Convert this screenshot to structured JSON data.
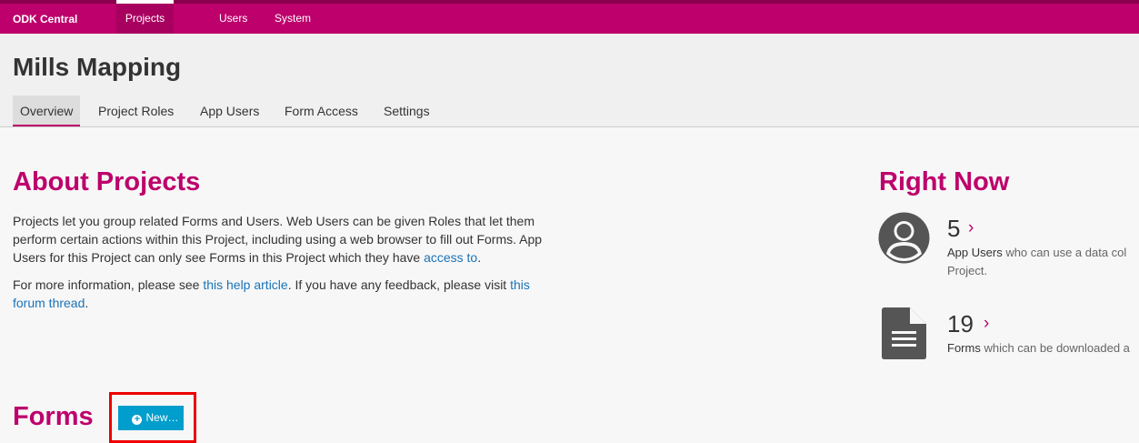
{
  "navbar": {
    "brand": "ODK Central",
    "items": [
      {
        "label": "Projects",
        "active": true
      },
      {
        "label": "Users"
      },
      {
        "label": "System"
      }
    ]
  },
  "header": {
    "title": "Mills Mapping",
    "tabs": [
      {
        "label": "Overview",
        "active": true
      },
      {
        "label": "Project Roles"
      },
      {
        "label": "App Users"
      },
      {
        "label": "Form Access"
      },
      {
        "label": "Settings"
      }
    ]
  },
  "about": {
    "title": "About Projects",
    "p1_text": "Projects let you group related Forms and Users. Web Users can be given Roles that let them perform certain actions within this Project, including using a web browser to fill out Forms. App Users for this Project can only see Forms in this Project which they have ",
    "p1_link": "access to",
    "p1_end": ".",
    "p2_text": "For more information, please see ",
    "p2_link1": "this help article",
    "p2_mid": ". If you have any feedback, please visit ",
    "p2_link2": "this forum thread",
    "p2_end": "."
  },
  "right_now": {
    "title": "Right Now",
    "stats": [
      {
        "icon": "user-circle-icon",
        "value": "5",
        "label": "App Users",
        "desc": " who can use a data col",
        "desc_line2": "Project."
      },
      {
        "icon": "file-icon",
        "value": "19",
        "label": "Forms",
        "desc": " which can be downloaded a"
      }
    ],
    "chevron": "›"
  },
  "forms": {
    "title": "Forms",
    "new_button": "New…"
  },
  "colors": {
    "brand": "#bd006b",
    "button": "#009ecc",
    "highlight": "#ee0000"
  }
}
